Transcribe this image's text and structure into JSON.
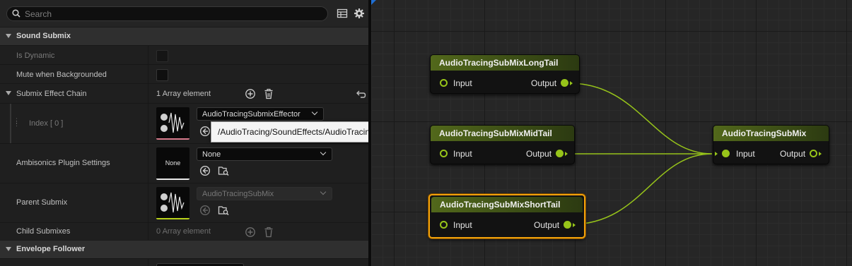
{
  "search": {
    "placeholder": "Search"
  },
  "toolbar": {
    "table_icon": "table-view-icon",
    "settings_icon": "gear-icon"
  },
  "categories": {
    "sound_submix": "Sound Submix",
    "envelope_follower": "Envelope Follower"
  },
  "properties": {
    "is_dynamic": {
      "label": "Is Dynamic",
      "checked": false
    },
    "mute_when_backgrounded": {
      "label": "Mute when Backgrounded",
      "checked": false
    },
    "submix_effect_chain": {
      "label": "Submix Effect Chain",
      "value": "1 Array element"
    },
    "index0": {
      "label": "Index [ 0 ]",
      "value": "AudioTracingSubmixEffector",
      "tooltip": "/AudioTracing/SoundEffects/AudioTracingSubmixEffectorShortTail"
    },
    "ambisonics": {
      "label": "Ambisonics Plugin Settings",
      "value": "None",
      "thumb_text": "None"
    },
    "parent_submix": {
      "label": "Parent Submix",
      "value": "AudioTracingSubMix"
    },
    "child_submixes": {
      "label": "Child Submixes",
      "value": "0 Array element"
    }
  },
  "colors": {
    "accent_selected": "#f2a10b",
    "pin_green": "#97c41a",
    "submix_thumb_bar": "#b9d21a",
    "effect_thumb_bar": "#d77a8c"
  },
  "graph": {
    "nodes": [
      {
        "title": "AudioTracingSubMixLongTail",
        "input": "Input",
        "output": "Output"
      },
      {
        "title": "AudioTracingSubMixMidTail",
        "input": "Input",
        "output": "Output"
      },
      {
        "title": "AudioTracingSubMixShortTail",
        "input": "Input",
        "output": "Output"
      },
      {
        "title": "AudioTracingSubMix",
        "input": "Input",
        "output": "Output"
      }
    ]
  }
}
